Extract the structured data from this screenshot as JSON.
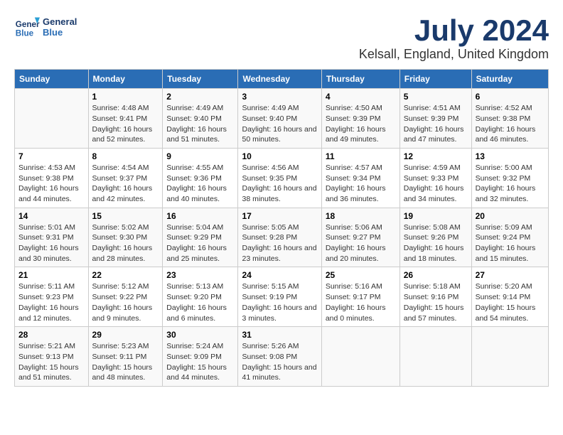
{
  "header": {
    "logo_line1": "General",
    "logo_line2": "Blue",
    "title": "July 2024",
    "subtitle": "Kelsall, England, United Kingdom"
  },
  "weekdays": [
    "Sunday",
    "Monday",
    "Tuesday",
    "Wednesday",
    "Thursday",
    "Friday",
    "Saturday"
  ],
  "weeks": [
    [
      {
        "num": "",
        "sunrise": "",
        "sunset": "",
        "daylight": ""
      },
      {
        "num": "1",
        "sunrise": "Sunrise: 4:48 AM",
        "sunset": "Sunset: 9:41 PM",
        "daylight": "Daylight: 16 hours and 52 minutes."
      },
      {
        "num": "2",
        "sunrise": "Sunrise: 4:49 AM",
        "sunset": "Sunset: 9:40 PM",
        "daylight": "Daylight: 16 hours and 51 minutes."
      },
      {
        "num": "3",
        "sunrise": "Sunrise: 4:49 AM",
        "sunset": "Sunset: 9:40 PM",
        "daylight": "Daylight: 16 hours and 50 minutes."
      },
      {
        "num": "4",
        "sunrise": "Sunrise: 4:50 AM",
        "sunset": "Sunset: 9:39 PM",
        "daylight": "Daylight: 16 hours and 49 minutes."
      },
      {
        "num": "5",
        "sunrise": "Sunrise: 4:51 AM",
        "sunset": "Sunset: 9:39 PM",
        "daylight": "Daylight: 16 hours and 47 minutes."
      },
      {
        "num": "6",
        "sunrise": "Sunrise: 4:52 AM",
        "sunset": "Sunset: 9:38 PM",
        "daylight": "Daylight: 16 hours and 46 minutes."
      }
    ],
    [
      {
        "num": "7",
        "sunrise": "Sunrise: 4:53 AM",
        "sunset": "Sunset: 9:38 PM",
        "daylight": "Daylight: 16 hours and 44 minutes."
      },
      {
        "num": "8",
        "sunrise": "Sunrise: 4:54 AM",
        "sunset": "Sunset: 9:37 PM",
        "daylight": "Daylight: 16 hours and 42 minutes."
      },
      {
        "num": "9",
        "sunrise": "Sunrise: 4:55 AM",
        "sunset": "Sunset: 9:36 PM",
        "daylight": "Daylight: 16 hours and 40 minutes."
      },
      {
        "num": "10",
        "sunrise": "Sunrise: 4:56 AM",
        "sunset": "Sunset: 9:35 PM",
        "daylight": "Daylight: 16 hours and 38 minutes."
      },
      {
        "num": "11",
        "sunrise": "Sunrise: 4:57 AM",
        "sunset": "Sunset: 9:34 PM",
        "daylight": "Daylight: 16 hours and 36 minutes."
      },
      {
        "num": "12",
        "sunrise": "Sunrise: 4:59 AM",
        "sunset": "Sunset: 9:33 PM",
        "daylight": "Daylight: 16 hours and 34 minutes."
      },
      {
        "num": "13",
        "sunrise": "Sunrise: 5:00 AM",
        "sunset": "Sunset: 9:32 PM",
        "daylight": "Daylight: 16 hours and 32 minutes."
      }
    ],
    [
      {
        "num": "14",
        "sunrise": "Sunrise: 5:01 AM",
        "sunset": "Sunset: 9:31 PM",
        "daylight": "Daylight: 16 hours and 30 minutes."
      },
      {
        "num": "15",
        "sunrise": "Sunrise: 5:02 AM",
        "sunset": "Sunset: 9:30 PM",
        "daylight": "Daylight: 16 hours and 28 minutes."
      },
      {
        "num": "16",
        "sunrise": "Sunrise: 5:04 AM",
        "sunset": "Sunset: 9:29 PM",
        "daylight": "Daylight: 16 hours and 25 minutes."
      },
      {
        "num": "17",
        "sunrise": "Sunrise: 5:05 AM",
        "sunset": "Sunset: 9:28 PM",
        "daylight": "Daylight: 16 hours and 23 minutes."
      },
      {
        "num": "18",
        "sunrise": "Sunrise: 5:06 AM",
        "sunset": "Sunset: 9:27 PM",
        "daylight": "Daylight: 16 hours and 20 minutes."
      },
      {
        "num": "19",
        "sunrise": "Sunrise: 5:08 AM",
        "sunset": "Sunset: 9:26 PM",
        "daylight": "Daylight: 16 hours and 18 minutes."
      },
      {
        "num": "20",
        "sunrise": "Sunrise: 5:09 AM",
        "sunset": "Sunset: 9:24 PM",
        "daylight": "Daylight: 16 hours and 15 minutes."
      }
    ],
    [
      {
        "num": "21",
        "sunrise": "Sunrise: 5:11 AM",
        "sunset": "Sunset: 9:23 PM",
        "daylight": "Daylight: 16 hours and 12 minutes."
      },
      {
        "num": "22",
        "sunrise": "Sunrise: 5:12 AM",
        "sunset": "Sunset: 9:22 PM",
        "daylight": "Daylight: 16 hours and 9 minutes."
      },
      {
        "num": "23",
        "sunrise": "Sunrise: 5:13 AM",
        "sunset": "Sunset: 9:20 PM",
        "daylight": "Daylight: 16 hours and 6 minutes."
      },
      {
        "num": "24",
        "sunrise": "Sunrise: 5:15 AM",
        "sunset": "Sunset: 9:19 PM",
        "daylight": "Daylight: 16 hours and 3 minutes."
      },
      {
        "num": "25",
        "sunrise": "Sunrise: 5:16 AM",
        "sunset": "Sunset: 9:17 PM",
        "daylight": "Daylight: 16 hours and 0 minutes."
      },
      {
        "num": "26",
        "sunrise": "Sunrise: 5:18 AM",
        "sunset": "Sunset: 9:16 PM",
        "daylight": "Daylight: 15 hours and 57 minutes."
      },
      {
        "num": "27",
        "sunrise": "Sunrise: 5:20 AM",
        "sunset": "Sunset: 9:14 PM",
        "daylight": "Daylight: 15 hours and 54 minutes."
      }
    ],
    [
      {
        "num": "28",
        "sunrise": "Sunrise: 5:21 AM",
        "sunset": "Sunset: 9:13 PM",
        "daylight": "Daylight: 15 hours and 51 minutes."
      },
      {
        "num": "29",
        "sunrise": "Sunrise: 5:23 AM",
        "sunset": "Sunset: 9:11 PM",
        "daylight": "Daylight: 15 hours and 48 minutes."
      },
      {
        "num": "30",
        "sunrise": "Sunrise: 5:24 AM",
        "sunset": "Sunset: 9:09 PM",
        "daylight": "Daylight: 15 hours and 44 minutes."
      },
      {
        "num": "31",
        "sunrise": "Sunrise: 5:26 AM",
        "sunset": "Sunset: 9:08 PM",
        "daylight": "Daylight: 15 hours and 41 minutes."
      },
      {
        "num": "",
        "sunrise": "",
        "sunset": "",
        "daylight": ""
      },
      {
        "num": "",
        "sunrise": "",
        "sunset": "",
        "daylight": ""
      },
      {
        "num": "",
        "sunrise": "",
        "sunset": "",
        "daylight": ""
      }
    ]
  ]
}
